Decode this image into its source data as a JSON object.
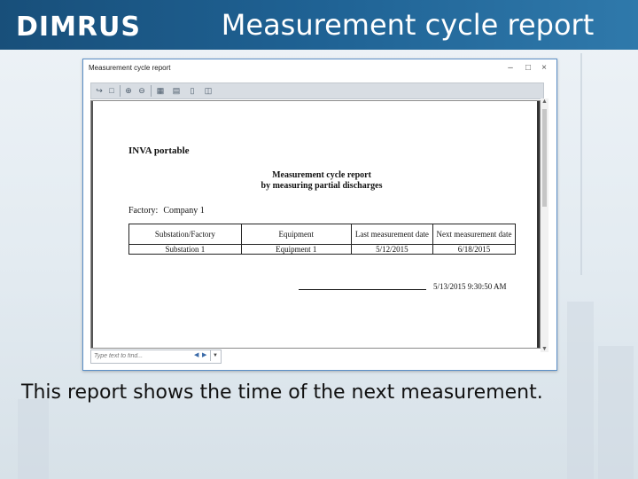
{
  "header": {
    "logo_text": "DIMRUS",
    "title": "Measurement cycle report"
  },
  "window": {
    "title": "Measurement cycle report",
    "controls": [
      "_",
      "□",
      "×"
    ],
    "toolbar_icons": [
      "open-icon",
      "save-icon",
      "zoom-in-icon",
      "zoom-out-icon",
      "page-setup-icon",
      "print-icon",
      "single-page-icon",
      "multi-page-icon"
    ]
  },
  "report": {
    "product": "INVA portable",
    "title_line1": "Measurement cycle report",
    "title_line2": "by measuring partial discharges",
    "factory_label": "Factory:",
    "factory_value": "Company 1",
    "columns": [
      "Substation/Factory",
      "Equipment",
      "Last measurement date",
      "Next measurement date"
    ],
    "rows": [
      [
        "Substation 1",
        "Equipment 1",
        "5/12/2015",
        "6/18/2015"
      ]
    ],
    "signature_timestamp": "5/13/2015 9:30:50 AM"
  },
  "findbar": {
    "placeholder": "Type text to find..."
  },
  "caption": "This report shows the time of the next measurement."
}
